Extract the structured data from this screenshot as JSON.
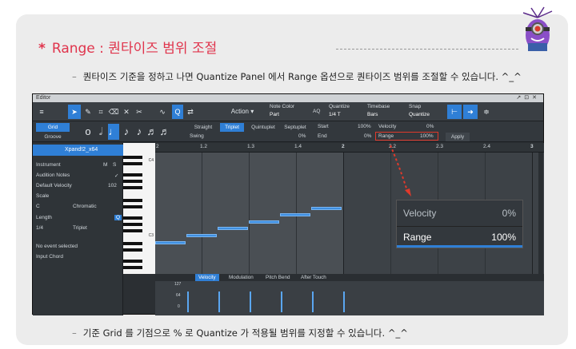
{
  "heading": {
    "star": "*",
    "text": "Range : 퀀타이즈 범위 조절"
  },
  "bullets": {
    "dash": "–",
    "top": "퀀타이즈 기준을 정하고 나면 Quantize Panel 에서 Range 옵션으로 퀀타이즈 범위를 조절할 수 있습니다. ^_^",
    "bottom": "기준 Grid 를 기점으로 % 로 Quantize 가 적용될 범위를 지정할 수 있습니다. ^_^"
  },
  "editor": {
    "window_title": "Editor",
    "toolbar": {
      "menu_icon": "≡",
      "action_label": "Action",
      "note_color_label": "Note Color",
      "note_color_value": "Part",
      "aq_label": "AQ",
      "quantize_label": "Quantize",
      "quantize_value": "1/4 T",
      "timebase_label": "Timebase",
      "timebase_value": "Bars",
      "snap_label": "Snap",
      "snap_value": "Quantize"
    },
    "grid_row": {
      "grid_label": "Grid",
      "groove_label": "Groove",
      "straight": "Straight",
      "triplet": "Triplet",
      "quintuplet": "Quintuplet",
      "septuplet": "Septuplet",
      "swing_label": "Swing",
      "swing_value": "0%",
      "start_label": "Start",
      "start_value": "100%",
      "end_label": "End",
      "end_value": "0%",
      "range_label": "Range",
      "range_value": "100%",
      "velocity_label": "Velocity",
      "velocity_value": "0%",
      "apply_label": "Apply"
    },
    "left_panel": {
      "track_name": "Xpand!2_x64",
      "instrument_label": "Instrument",
      "mute": "M",
      "solo": "S",
      "audition_label": "Audition Notes",
      "default_velocity_label": "Default Velocity",
      "default_velocity_value": "102",
      "scale_label": "Scale",
      "scale_root": "C",
      "scale_type": "Chromatic",
      "length_label": "Length",
      "length_value": "1/4",
      "length_mode": "Triplet",
      "no_event": "No event selected",
      "input_chord": "Input Chord"
    },
    "piano_labels": [
      "C4",
      "C3"
    ],
    "ruler_ticks": [
      "2",
      "1.2",
      "1.3",
      "1.4",
      "2",
      "2.2",
      "2.3",
      "2.4",
      "3"
    ],
    "tabs": [
      "Velocity",
      "Modulation",
      "Pitch Bend",
      "After Touch"
    ],
    "velocity_scale": [
      "127",
      "64",
      "0"
    ]
  },
  "zoom": {
    "velocity_label": "Velocity",
    "velocity_value": "0%",
    "range_label": "Range",
    "range_value": "100%"
  }
}
